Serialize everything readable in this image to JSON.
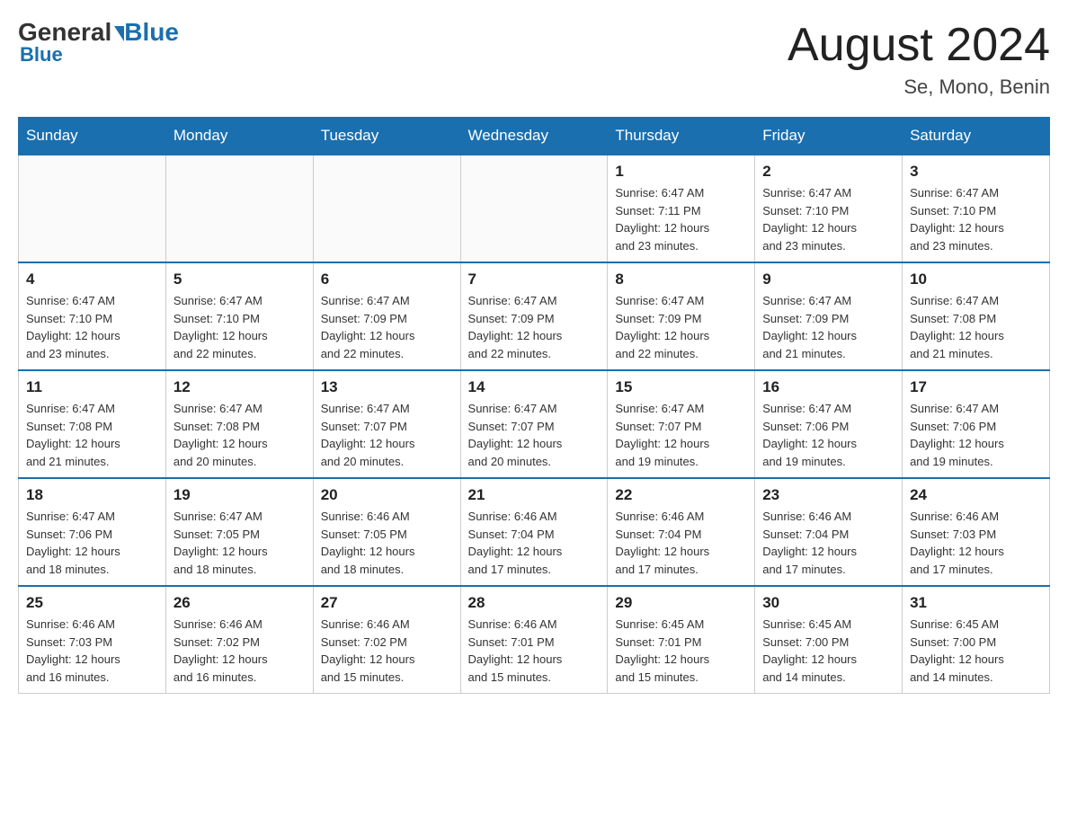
{
  "header": {
    "logo_general": "General",
    "logo_blue": "Blue",
    "month_title": "August 2024",
    "location": "Se, Mono, Benin"
  },
  "days_of_week": [
    "Sunday",
    "Monday",
    "Tuesday",
    "Wednesday",
    "Thursday",
    "Friday",
    "Saturday"
  ],
  "weeks": [
    [
      {
        "day": "",
        "info": ""
      },
      {
        "day": "",
        "info": ""
      },
      {
        "day": "",
        "info": ""
      },
      {
        "day": "",
        "info": ""
      },
      {
        "day": "1",
        "info": "Sunrise: 6:47 AM\nSunset: 7:11 PM\nDaylight: 12 hours\nand 23 minutes."
      },
      {
        "day": "2",
        "info": "Sunrise: 6:47 AM\nSunset: 7:10 PM\nDaylight: 12 hours\nand 23 minutes."
      },
      {
        "day": "3",
        "info": "Sunrise: 6:47 AM\nSunset: 7:10 PM\nDaylight: 12 hours\nand 23 minutes."
      }
    ],
    [
      {
        "day": "4",
        "info": "Sunrise: 6:47 AM\nSunset: 7:10 PM\nDaylight: 12 hours\nand 23 minutes."
      },
      {
        "day": "5",
        "info": "Sunrise: 6:47 AM\nSunset: 7:10 PM\nDaylight: 12 hours\nand 22 minutes."
      },
      {
        "day": "6",
        "info": "Sunrise: 6:47 AM\nSunset: 7:09 PM\nDaylight: 12 hours\nand 22 minutes."
      },
      {
        "day": "7",
        "info": "Sunrise: 6:47 AM\nSunset: 7:09 PM\nDaylight: 12 hours\nand 22 minutes."
      },
      {
        "day": "8",
        "info": "Sunrise: 6:47 AM\nSunset: 7:09 PM\nDaylight: 12 hours\nand 22 minutes."
      },
      {
        "day": "9",
        "info": "Sunrise: 6:47 AM\nSunset: 7:09 PM\nDaylight: 12 hours\nand 21 minutes."
      },
      {
        "day": "10",
        "info": "Sunrise: 6:47 AM\nSunset: 7:08 PM\nDaylight: 12 hours\nand 21 minutes."
      }
    ],
    [
      {
        "day": "11",
        "info": "Sunrise: 6:47 AM\nSunset: 7:08 PM\nDaylight: 12 hours\nand 21 minutes."
      },
      {
        "day": "12",
        "info": "Sunrise: 6:47 AM\nSunset: 7:08 PM\nDaylight: 12 hours\nand 20 minutes."
      },
      {
        "day": "13",
        "info": "Sunrise: 6:47 AM\nSunset: 7:07 PM\nDaylight: 12 hours\nand 20 minutes."
      },
      {
        "day": "14",
        "info": "Sunrise: 6:47 AM\nSunset: 7:07 PM\nDaylight: 12 hours\nand 20 minutes."
      },
      {
        "day": "15",
        "info": "Sunrise: 6:47 AM\nSunset: 7:07 PM\nDaylight: 12 hours\nand 19 minutes."
      },
      {
        "day": "16",
        "info": "Sunrise: 6:47 AM\nSunset: 7:06 PM\nDaylight: 12 hours\nand 19 minutes."
      },
      {
        "day": "17",
        "info": "Sunrise: 6:47 AM\nSunset: 7:06 PM\nDaylight: 12 hours\nand 19 minutes."
      }
    ],
    [
      {
        "day": "18",
        "info": "Sunrise: 6:47 AM\nSunset: 7:06 PM\nDaylight: 12 hours\nand 18 minutes."
      },
      {
        "day": "19",
        "info": "Sunrise: 6:47 AM\nSunset: 7:05 PM\nDaylight: 12 hours\nand 18 minutes."
      },
      {
        "day": "20",
        "info": "Sunrise: 6:46 AM\nSunset: 7:05 PM\nDaylight: 12 hours\nand 18 minutes."
      },
      {
        "day": "21",
        "info": "Sunrise: 6:46 AM\nSunset: 7:04 PM\nDaylight: 12 hours\nand 17 minutes."
      },
      {
        "day": "22",
        "info": "Sunrise: 6:46 AM\nSunset: 7:04 PM\nDaylight: 12 hours\nand 17 minutes."
      },
      {
        "day": "23",
        "info": "Sunrise: 6:46 AM\nSunset: 7:04 PM\nDaylight: 12 hours\nand 17 minutes."
      },
      {
        "day": "24",
        "info": "Sunrise: 6:46 AM\nSunset: 7:03 PM\nDaylight: 12 hours\nand 17 minutes."
      }
    ],
    [
      {
        "day": "25",
        "info": "Sunrise: 6:46 AM\nSunset: 7:03 PM\nDaylight: 12 hours\nand 16 minutes."
      },
      {
        "day": "26",
        "info": "Sunrise: 6:46 AM\nSunset: 7:02 PM\nDaylight: 12 hours\nand 16 minutes."
      },
      {
        "day": "27",
        "info": "Sunrise: 6:46 AM\nSunset: 7:02 PM\nDaylight: 12 hours\nand 15 minutes."
      },
      {
        "day": "28",
        "info": "Sunrise: 6:46 AM\nSunset: 7:01 PM\nDaylight: 12 hours\nand 15 minutes."
      },
      {
        "day": "29",
        "info": "Sunrise: 6:45 AM\nSunset: 7:01 PM\nDaylight: 12 hours\nand 15 minutes."
      },
      {
        "day": "30",
        "info": "Sunrise: 6:45 AM\nSunset: 7:00 PM\nDaylight: 12 hours\nand 14 minutes."
      },
      {
        "day": "31",
        "info": "Sunrise: 6:45 AM\nSunset: 7:00 PM\nDaylight: 12 hours\nand 14 minutes."
      }
    ]
  ]
}
